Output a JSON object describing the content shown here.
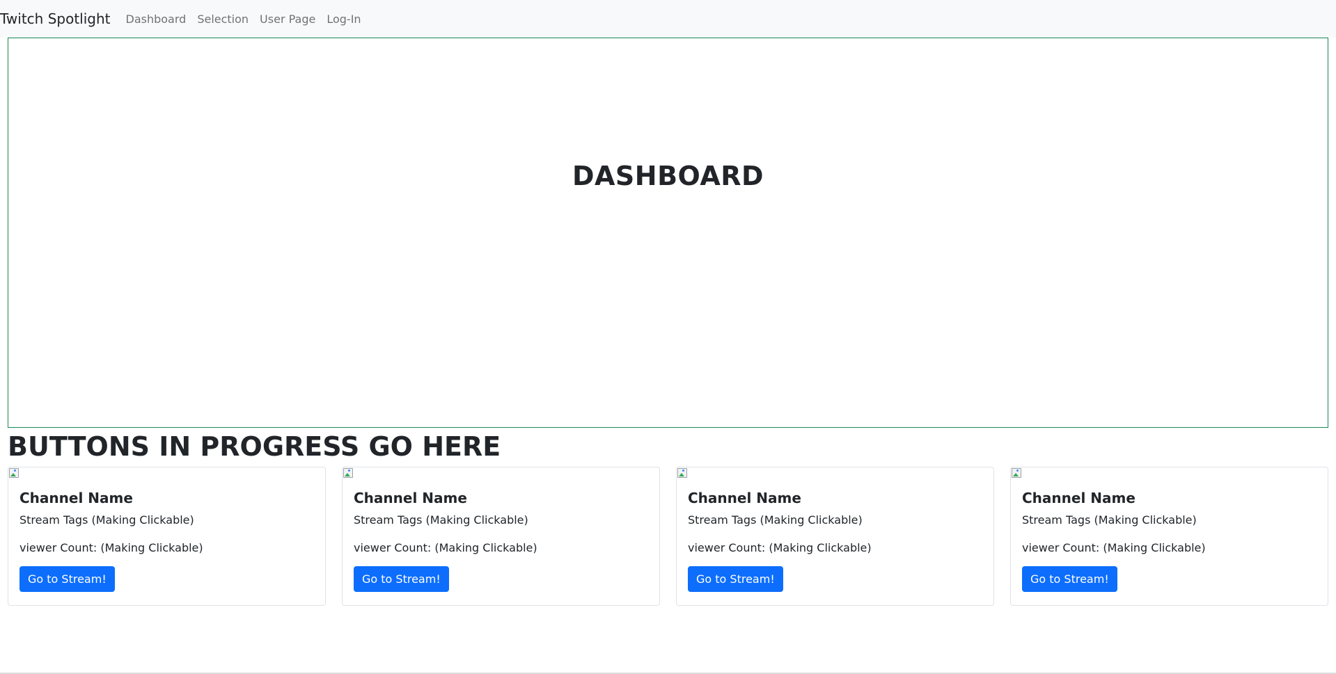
{
  "navbar": {
    "brand": "Twitch Spotlight",
    "links": [
      {
        "label": "Dashboard"
      },
      {
        "label": "Selection"
      },
      {
        "label": "User Page"
      },
      {
        "label": "Log-In"
      }
    ]
  },
  "dashboard": {
    "title": "DASHBOARD"
  },
  "section": {
    "heading": "BUTTONS IN PROGRESS GO HERE"
  },
  "cards": [
    {
      "channel_name": "Channel Name",
      "tags": "Stream Tags (Making Clickable)",
      "viewers": "viewer Count: (Making Clickable)",
      "button": "Go to Stream!",
      "image_icon": "broken-image-icon"
    },
    {
      "channel_name": "Channel Name",
      "tags": "Stream Tags (Making Clickable)",
      "viewers": "viewer Count: (Making Clickable)",
      "button": "Go to Stream!",
      "image_icon": "broken-image-icon"
    },
    {
      "channel_name": "Channel Name",
      "tags": "Stream Tags (Making Clickable)",
      "viewers": "viewer Count: (Making Clickable)",
      "button": "Go to Stream!",
      "image_icon": "broken-image-icon"
    },
    {
      "channel_name": "Channel Name",
      "tags": "Stream Tags (Making Clickable)",
      "viewers": "viewer Count: (Making Clickable)",
      "button": "Go to Stream!",
      "image_icon": "broken-image-icon"
    }
  ],
  "colors": {
    "navbar_bg": "#f8f9fa",
    "dashboard_border": "#198754",
    "button_primary": "#0d6efd",
    "card_border": "#dfe2e6"
  }
}
